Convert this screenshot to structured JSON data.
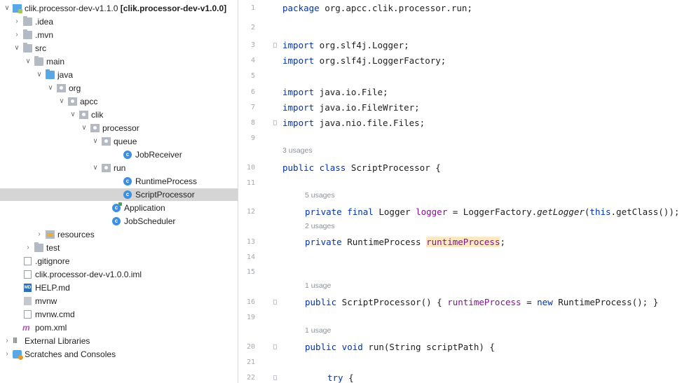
{
  "tree": {
    "project_label": "clik.processor-dev-v1.1.0",
    "project_badge": "[clik.processor-dev-v1.0.0]",
    "items": [
      {
        "label": "clik.processor-dev-v1.1.0",
        "icon": "module-icon"
      },
      {
        "label": ".idea",
        "icon": "folder-icon"
      },
      {
        "label": ".mvn",
        "icon": "folder-icon"
      },
      {
        "label": "src",
        "icon": "folder-icon"
      },
      {
        "label": "main",
        "icon": "folder-icon"
      },
      {
        "label": "java",
        "icon": "source-folder-icon"
      },
      {
        "label": "org",
        "icon": "package-icon"
      },
      {
        "label": "apcc",
        "icon": "package-icon"
      },
      {
        "label": "clik",
        "icon": "package-icon"
      },
      {
        "label": "processor",
        "icon": "package-icon"
      },
      {
        "label": "queue",
        "icon": "package-icon"
      },
      {
        "label": "JobReceiver",
        "icon": "class-icon"
      },
      {
        "label": "run",
        "icon": "package-icon"
      },
      {
        "label": "RuntimeProcess",
        "icon": "class-icon"
      },
      {
        "label": "ScriptProcessor",
        "icon": "class-icon"
      },
      {
        "label": "Application",
        "icon": "spring-app-class-icon"
      },
      {
        "label": "JobScheduler",
        "icon": "class-icon"
      },
      {
        "label": "resources",
        "icon": "resources-folder-icon"
      },
      {
        "label": "test",
        "icon": "folder-icon"
      },
      {
        "label": ".gitignore",
        "icon": "gitignore-file-icon"
      },
      {
        "label": "clik.processor-dev-v1.0.0.iml",
        "icon": "iml-file-icon"
      },
      {
        "label": "HELP.md",
        "icon": "markdown-file-icon"
      },
      {
        "label": "mvnw",
        "icon": "terminal-file-icon"
      },
      {
        "label": "mvnw.cmd",
        "icon": "text-file-icon"
      },
      {
        "label": "pom.xml",
        "icon": "maven-file-icon"
      },
      {
        "label": "External Libraries",
        "icon": "libraries-icon"
      },
      {
        "label": "Scratches and Consoles",
        "icon": "scratches-icon"
      }
    ],
    "selected": "ScriptProcessor"
  },
  "editor": {
    "line_numbers": [
      "1",
      "2",
      "3",
      "4",
      "5",
      "6",
      "7",
      "8",
      "9",
      "10",
      "11",
      "12",
      "13",
      "14",
      "15",
      "16",
      "19",
      "20",
      "21",
      "22"
    ],
    "usage_hints": {
      "class": "3 usages",
      "logger": "5 usages",
      "runtime": "2 usages",
      "ctor": "1 usage",
      "run": "1 usage"
    },
    "code": {
      "l1_kw": "package",
      "l1_rest": " org.apcc.clik.processor.run;",
      "l3_kw": "import",
      "l3_rest": " org.slf4j.Logger;",
      "l4_kw": "import",
      "l4_rest": " org.slf4j.LoggerFactory;",
      "l6_kw": "import",
      "l6_rest": " java.io.File;",
      "l7_kw": "import",
      "l7_rest": " java.io.FileWriter;",
      "l8_kw": "import",
      "l8_rest": " java.nio.file.Files;",
      "l10_kw": "public class",
      "l10_rest": " ScriptProcessor {",
      "l12_kw": "private final",
      "l12_a": " Logger ",
      "l12_field": "logger",
      "l12_b": " = LoggerFactory.",
      "l12_method": "getLogger",
      "l12_c": "(",
      "l12_this": "this",
      "l12_d": ".getClass());",
      "l13_kw": "private",
      "l13_a": " RuntimeProcess ",
      "l13_field": "runtimeProcess",
      "l13_b": ";",
      "l16_kw": "public",
      "l16_a": " ScriptProcessor() { ",
      "l16_field": "runtimeProcess",
      "l16_b": " = ",
      "l16_new": "new",
      "l16_c": " RuntimeProcess(); }",
      "l20_kw": "public void",
      "l20_rest": " run(String scriptPath) {",
      "l22_kw": "try",
      "l22_rest": " {"
    }
  },
  "colors": {
    "keyword": "#0033b3",
    "field": "#871094",
    "selection": "#d5d5d5",
    "highlight": "#fce8c2"
  }
}
